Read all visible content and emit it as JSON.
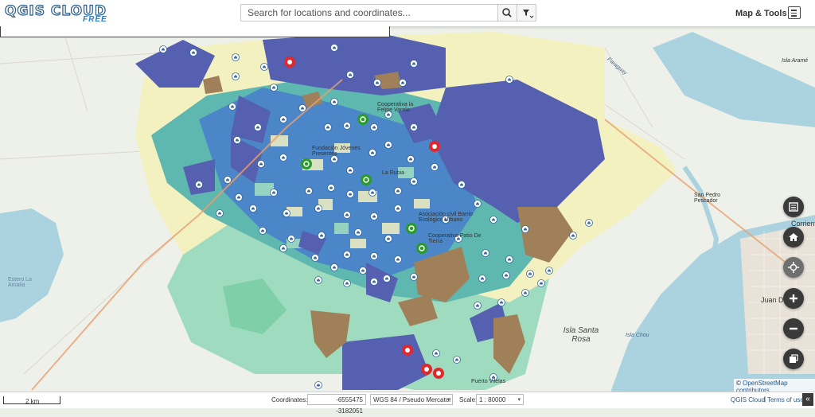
{
  "app": {
    "logo_main": "QGIS CLOUD",
    "logo_sub": "FREE"
  },
  "search": {
    "placeholder": "Search for locations and coordinates..."
  },
  "header": {
    "map_tools_label": "Map & Tools"
  },
  "icons": {
    "search": "search-icon",
    "filter": "filter-icon",
    "menu": "hamburger-menu-icon",
    "legend": "list-icon",
    "home": "home-icon",
    "locate": "crosshair-icon",
    "zoom_in": "plus-icon",
    "zoom_out": "minus-icon",
    "layers": "layers-icon"
  },
  "map": {
    "labels": [
      {
        "text": "Cooperativa la Felipe Varela"
      },
      {
        "text": "Fundación Jóvenes Presentes"
      },
      {
        "text": "La Rubia"
      },
      {
        "text": "Asociación civil Barrio Ecológico Urbano"
      },
      {
        "text": "Cooperativa Patio De Tierra"
      },
      {
        "text": "Isla Santa Rosa"
      },
      {
        "text": "Isla Chou"
      },
      {
        "text": "San Pedro Pescador"
      },
      {
        "text": "Isla Aramé"
      },
      {
        "text": "Paraguay"
      },
      {
        "text": "Estero La Amalia"
      },
      {
        "text": "Juan De"
      },
      {
        "text": "Puerto Vilelas"
      },
      {
        "text": "Corrientes"
      }
    ],
    "colors": {
      "dark_blue": "#5560b0",
      "blue": "#4a86c8",
      "teal": "#5fb8b0",
      "green": "#9fdcbf",
      "yellow": "#f4f1c0",
      "brown": "#a08058",
      "water": "#aad3df",
      "marker_home": "#ffffff",
      "marker_red": "#e0282d",
      "marker_green": "#2a9a2a"
    }
  },
  "controls": {
    "attribution_prefix": "© ",
    "attribution_link": "OpenStreetMap contributors"
  },
  "footer": {
    "scalebar_label": "2 km",
    "coordinates_label": "Coordinates:",
    "coordinates_value": "-6555475 -3182051",
    "crs_value": "WGS 84 / Pseudo Mercator",
    "scale_label": "Scale:",
    "scale_value": "1 : 80000",
    "qgis_link": "QGIS Cloud",
    "separator": "|",
    "terms_link": "Terms of use",
    "collapse_icon": "«"
  }
}
